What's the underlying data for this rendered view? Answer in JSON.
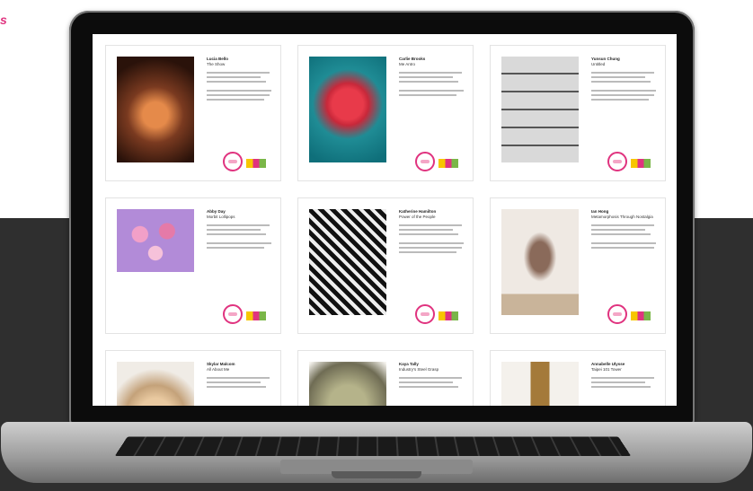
{
  "corner_text": "s",
  "cards": [
    {
      "name": "Lucia Bello",
      "title": "The Show"
    },
    {
      "name": "Carlie Brooks",
      "title": "Me Antro"
    },
    {
      "name": "Yunsun Chung",
      "title": "Untitled"
    },
    {
      "name": "Abby Day",
      "title": "Morbit Lollipops"
    },
    {
      "name": "Katherine Hamilton",
      "title": "Power of the People"
    },
    {
      "name": "Ian Hong",
      "title": "Metamorphosis Through Nostalgia"
    },
    {
      "name": "Skylar Malcom",
      "title": "All About Me"
    },
    {
      "name": "Kaya Tally",
      "title": "Industry's Steel Grasp"
    },
    {
      "name": "Annabelle Ulysse",
      "title": "Taipei 101 Tower"
    }
  ],
  "colors": {
    "accent": "#e0337f",
    "background_band": "#2f2f2f"
  }
}
